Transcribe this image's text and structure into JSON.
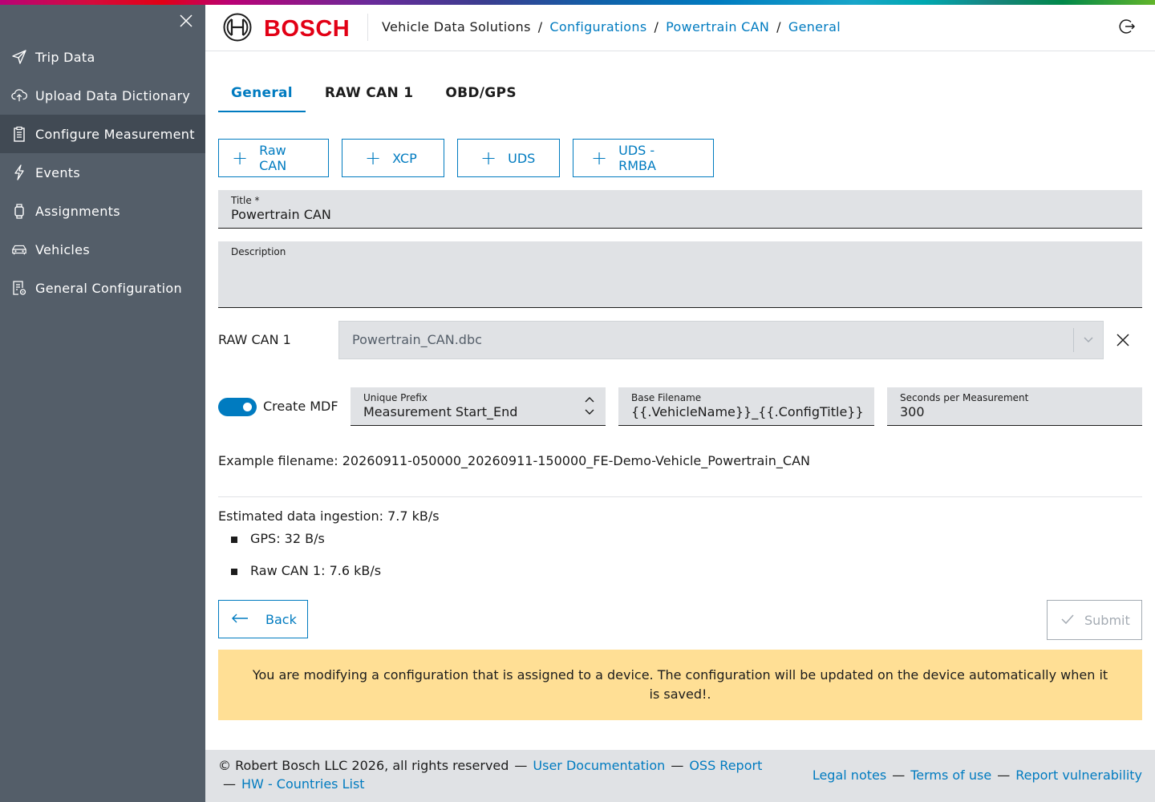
{
  "brand": {
    "name": "BOSCH",
    "color": "#e20015",
    "accent": "#007bc0"
  },
  "sidebar": {
    "items": [
      {
        "label": "Trip Data",
        "icon": "send-icon"
      },
      {
        "label": "Upload Data Dictionary",
        "icon": "cloud-upload-icon"
      },
      {
        "label": "Configure Measurement",
        "icon": "clipboard-icon",
        "active": true
      },
      {
        "label": "Events",
        "icon": "lightning-icon"
      },
      {
        "label": "Assignments",
        "icon": "watch-icon"
      },
      {
        "label": "Vehicles",
        "icon": "car-icon"
      },
      {
        "label": "General Configuration",
        "icon": "document-settings-icon"
      }
    ]
  },
  "header": {
    "breadcrumb": {
      "root": "Vehicle Data Solutions",
      "links": [
        "Configurations",
        "Powertrain CAN",
        "General"
      ],
      "separator": "/"
    }
  },
  "tabs": [
    "General",
    "RAW CAN 1",
    "OBD/GPS"
  ],
  "add_buttons": [
    "Raw CAN",
    "XCP",
    "UDS",
    "UDS - RMBA"
  ],
  "form": {
    "title": {
      "label": "Title *",
      "value": "Powertrain CAN"
    },
    "description": {
      "label": "Description",
      "value": ""
    },
    "raw_can": {
      "label": "RAW CAN 1",
      "selected": "Powertrain_CAN.dbc"
    },
    "create_mdf": {
      "label": "Create MDF",
      "on": true
    },
    "unique_prefix": {
      "label": "Unique Prefix",
      "value": "Measurement Start_End"
    },
    "base_filename": {
      "label": "Base Filename",
      "value": "{{.VehicleName}}_{{.ConfigTitle}}"
    },
    "seconds": {
      "label": "Seconds per Measurement",
      "value": "300"
    }
  },
  "example_filename": "Example filename: 20260911-050000_20260911-150000_FE-Demo-Vehicle_Powertrain_CAN",
  "estimate": {
    "title": "Estimated data ingestion: 7.7 kB/s",
    "items": [
      "GPS: 32 B/s",
      "Raw CAN 1: 7.6 kB/s"
    ]
  },
  "actions": {
    "back": "Back",
    "submit": "Submit"
  },
  "notice": "You are modifying a configuration that is assigned to a device. The configuration will be updated on the device automatically when it is saved!.",
  "footer": {
    "copyright": "© Robert Bosch LLC 2026, all rights reserved",
    "dash": "—",
    "links_left": [
      "User Documentation",
      "OSS Report"
    ],
    "link_left2": "HW - Countries List",
    "links_right": [
      "Legal notes",
      "Terms of use",
      "Report vulnerability"
    ]
  }
}
